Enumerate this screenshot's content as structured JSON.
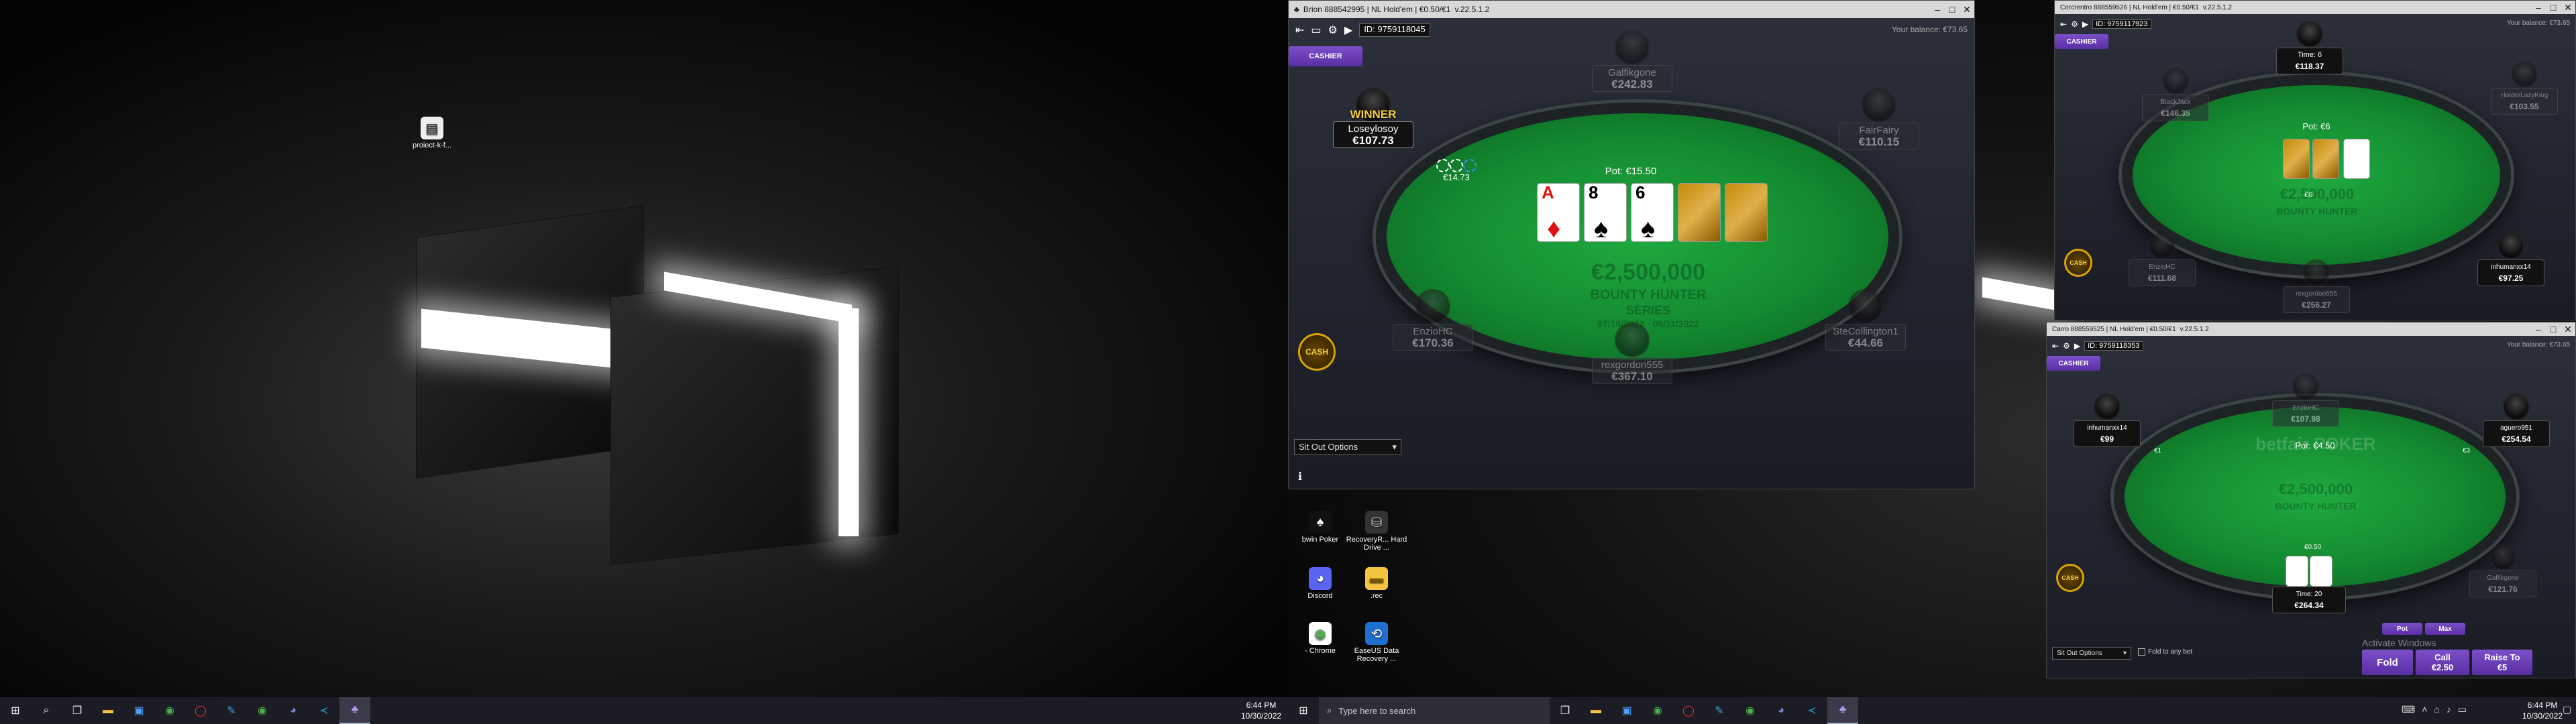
{
  "monitor1": {
    "desktop_icons": [
      {
        "label": "proiect-k-f...",
        "icon": "file-icon"
      }
    ],
    "taskbar": {
      "icons": [
        "windows-start-icon",
        "search-icon",
        "task-view-icon",
        "file-explorer-icon",
        "store-icon",
        "chrome-icon",
        "opera-icon",
        "app-icon",
        "chrome-icon",
        "discord-icon",
        "vscode-icon",
        "poker-app-icon"
      ],
      "time": "6:44 PM",
      "date": "10/30/2022"
    }
  },
  "monitor2": {
    "desktop_icons": [
      {
        "label": "bwin Poker",
        "icon": "poker-client-icon"
      },
      {
        "label": "RecoveryR... Hard Drive ...",
        "icon": "recovery-icon"
      },
      {
        "label": "Discord",
        "icon": "discord-icon"
      },
      {
        "label": ".rec",
        "icon": "folder-icon"
      },
      {
        "label": "- Chrome",
        "icon": "chrome-icon"
      },
      {
        "label": "EaseUS Data Recovery ...",
        "icon": "easeus-icon"
      }
    ],
    "taskbar": {
      "search_placeholder": "Type here to search",
      "time": "6:44 PM",
      "date": "10/30/2022"
    }
  },
  "table1": {
    "title": "Brion 888542995 | NL Hold'em | €0.50/€1",
    "version": "v.22.5.1.2",
    "id": "ID: 9759118045",
    "balance": "Your balance: €73.65",
    "cashier": "CASHIER",
    "pot": "Pot: €15.50",
    "felt_text": [
      "€2,500,000",
      "BOUNTY HUNTER",
      "SERIES",
      "07/10/2022 - 06/11/2022"
    ],
    "seats": [
      {
        "name": "Galfikgone",
        "stack": "€242.83"
      },
      {
        "name": "FairFairy",
        "stack": "€110.15"
      },
      {
        "name": "SteCollington1",
        "stack": "€44.66"
      },
      {
        "name": "rexgordon555",
        "stack": "€367.10"
      },
      {
        "name": "EnzioHC",
        "stack": "€170.36"
      },
      {
        "name": "Loseylosoy",
        "stack": "€107.73"
      }
    ],
    "winner": "WINNER",
    "bet": "€14.73",
    "board": [
      {
        "rank": "A",
        "suit": "♦",
        "red": true
      },
      {
        "rank": "8",
        "suit": "♠",
        "red": false
      },
      {
        "rank": "6",
        "suit": "♠",
        "red": false
      }
    ],
    "cash_badge": "CASH",
    "sit_out": "Sit Out Options"
  },
  "table2": {
    "title": "Cercrentro 888559526 | NL Hold'em | €0.50/€1",
    "version": "v.22.5.1.2",
    "id": "ID: 9759117923",
    "balance": "Your balance: €73.65",
    "cashier": "CASHIER",
    "pot": "Pot: €6",
    "seats": [
      {
        "name": "Time: 6",
        "stack": "€118.37"
      },
      {
        "name": "HolderLazyKing",
        "stack": "€103.55"
      },
      {
        "name": "inhumanxx14",
        "stack": "€97.25"
      },
      {
        "name": "rexgordon555",
        "stack": "€256.27"
      },
      {
        "name": "EnzioHC",
        "stack": "€111.68"
      },
      {
        "name": "BlackJack",
        "stack": "€146.35"
      }
    ],
    "bet": "€6",
    "felt_text": [
      "€2,500,000",
      "BOUNTY HUNTER",
      "SERIES"
    ],
    "cash_badge": "CASH"
  },
  "table3": {
    "title": "Carro 888559525 | NL Hold'em | €0.50/€1",
    "version": "v.22.5.1.2",
    "id": "ID: 9759118353",
    "balance": "Your balance: €73.65",
    "cashier": "CASHIER",
    "pot": "Pot: €4.50",
    "brand": "betfair POKER",
    "seats": [
      {
        "name": "EnzioHC",
        "stack": "€107.98"
      },
      {
        "name": "aguero951",
        "stack": "€254.54"
      },
      {
        "name": "Galfikgone",
        "stack": "€121.76"
      },
      {
        "name": "Time: 20",
        "stack": "€264.34"
      },
      {
        "name": "inhumanxx14",
        "stack": "€99"
      }
    ],
    "bets": [
      "€1",
      "€3",
      "€0.50"
    ],
    "felt_text": [
      "€2,500,000",
      "BOUNTY HUNTER",
      "SERIES"
    ],
    "cash_badge": "CASH",
    "sit_out": "Sit Out Options",
    "fold_any": "Fold to any bet",
    "actions": {
      "pot": "Pot",
      "max": "Max",
      "fold": "Fold",
      "call": "Call",
      "call_amt": "€2.50",
      "raise": "Raise To",
      "raise_amt": "€5"
    },
    "activate": "Activate Windows"
  }
}
